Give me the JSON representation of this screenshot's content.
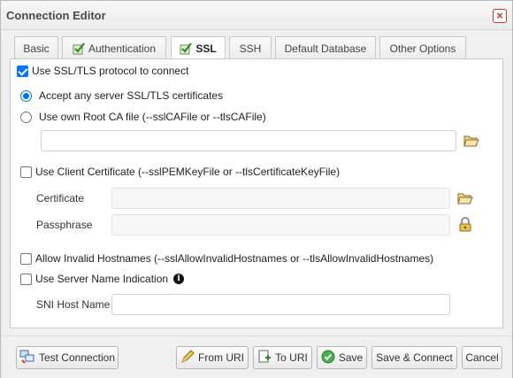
{
  "window": {
    "title": "Connection Editor"
  },
  "tabs": [
    {
      "label": "Basic",
      "checked": false
    },
    {
      "label": "Authentication",
      "checked": true
    },
    {
      "label": "SSL",
      "checked": true,
      "active": true
    },
    {
      "label": "SSH",
      "checked": false
    },
    {
      "label": "Default Database",
      "checked": false
    },
    {
      "label": "Other Options",
      "checked": false
    }
  ],
  "ssl": {
    "use_ssl_label": "Use SSL/TLS protocol to connect",
    "use_ssl_checked": true,
    "accept_any_label": "Accept any server SSL/TLS certificates",
    "accept_any_selected": true,
    "own_ca_label": "Use own Root CA file (--sslCAFile or --tlsCAFile)",
    "own_ca_selected": false,
    "ca_file_value": "",
    "client_cert_label": "Use Client Certificate (--sslPEMKeyFile or --tlsCertificateKeyFile)",
    "client_cert_checked": false,
    "certificate_label": "Certificate",
    "certificate_value": "",
    "passphrase_label": "Passphrase",
    "passphrase_value": "",
    "invalid_hostnames_label": "Allow Invalid Hostnames (--sslAllowInvalidHostnames or --tlsAllowInvalidHostnames)",
    "invalid_hostnames_checked": false,
    "sni_label": "Use Server Name Indication",
    "sni_checked": false,
    "sni_host_label": "SNI Host Name",
    "sni_host_value": ""
  },
  "footer": {
    "test_connection": "Test Connection",
    "from_uri": "From URI",
    "to_uri": "To URI",
    "save": "Save",
    "save_connect": "Save & Connect",
    "cancel": "Cancel"
  },
  "colors": {
    "accent": "#0075ff",
    "close": "#c0392b",
    "check_green": "#2e8b2e"
  }
}
